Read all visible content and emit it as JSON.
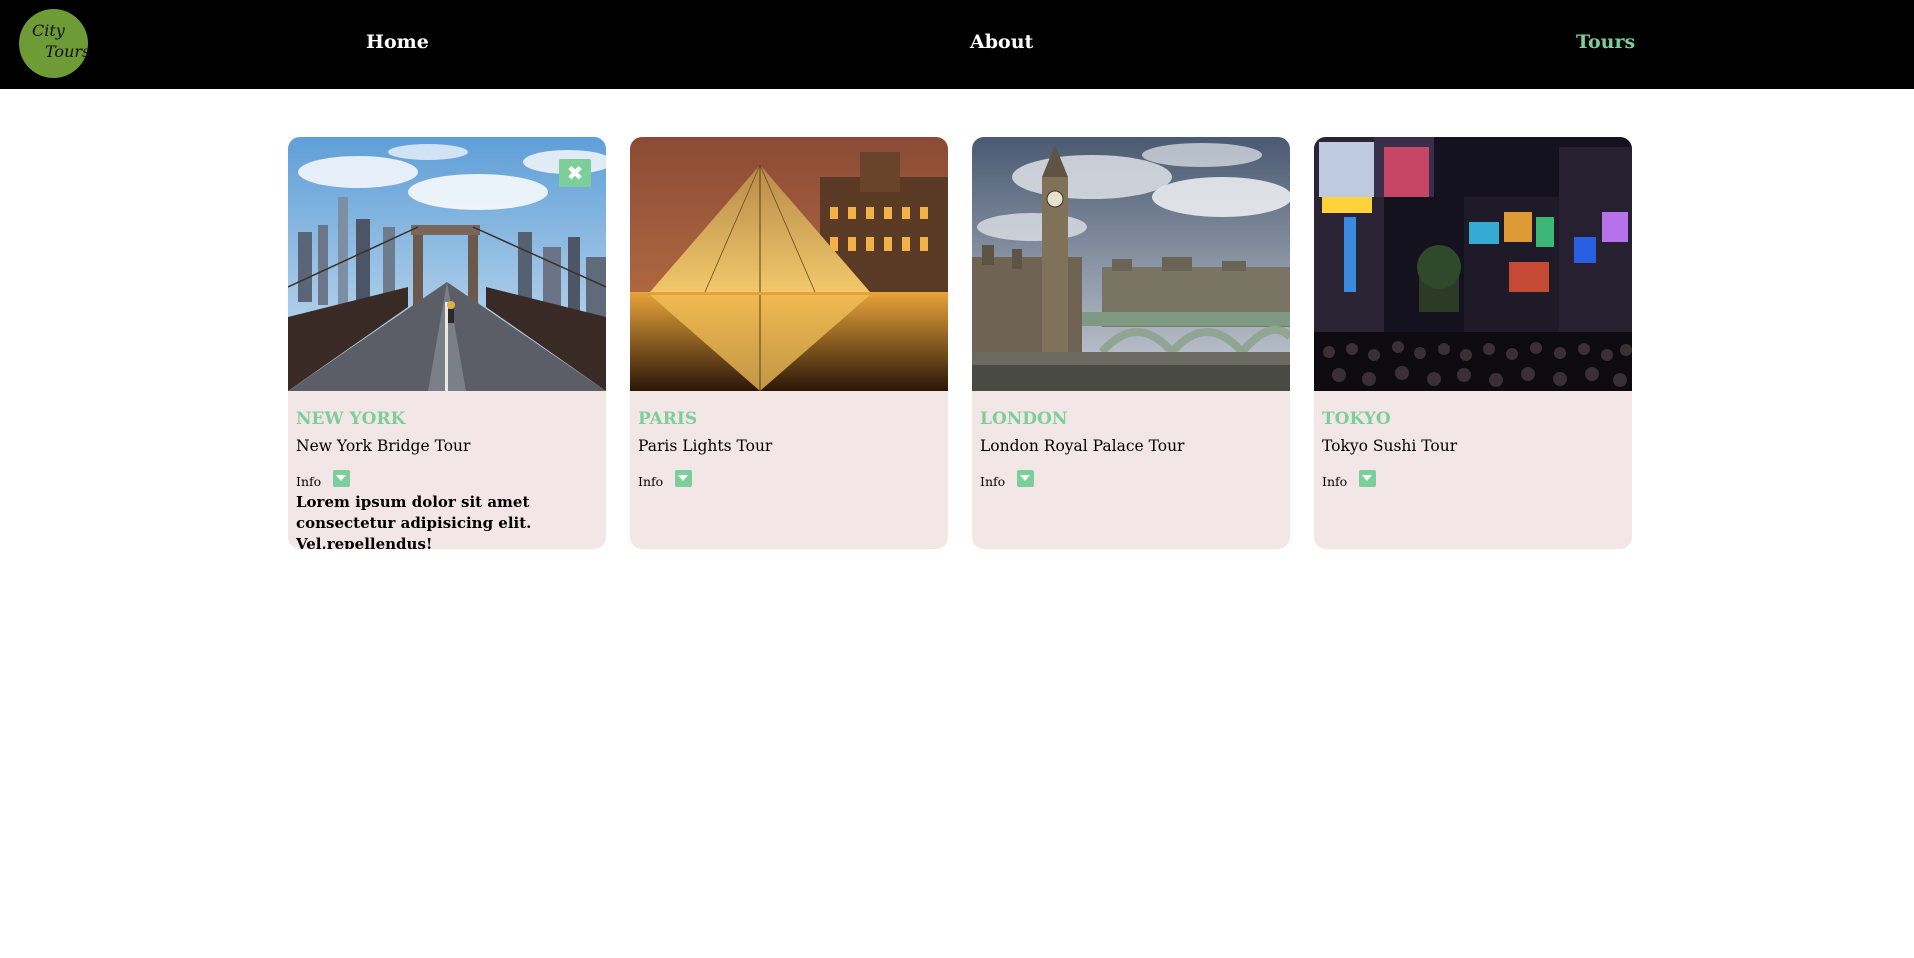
{
  "brand": {
    "line1": "City",
    "line2": "Tours"
  },
  "nav": [
    {
      "label": "Home"
    },
    {
      "label": "About"
    },
    {
      "label": "Tours"
    }
  ],
  "colors": {
    "accent": "#7ccf9a",
    "logo": "#6f9b36",
    "card_bg": "#f2e6e6",
    "nav_bg": "#000000"
  },
  "icons": {
    "close": "close-icon",
    "toggle": "caret-down-icon"
  },
  "tours": [
    {
      "city": "NEW YORK",
      "name": "New York Bridge Tour",
      "info_label": "Info",
      "info_text": "Lorem ipsum dolor sit amet consectetur adipisicing elit. Vel,repellendus!",
      "close": "✖"
    },
    {
      "city": "PARIS",
      "name": "Paris Lights Tour",
      "info_label": "Info"
    },
    {
      "city": "LONDON",
      "name": "London Royal Palace Tour",
      "info_label": "Info"
    },
    {
      "city": "TOKYO",
      "name": "Tokyo Sushi Tour",
      "info_label": "Info"
    }
  ]
}
